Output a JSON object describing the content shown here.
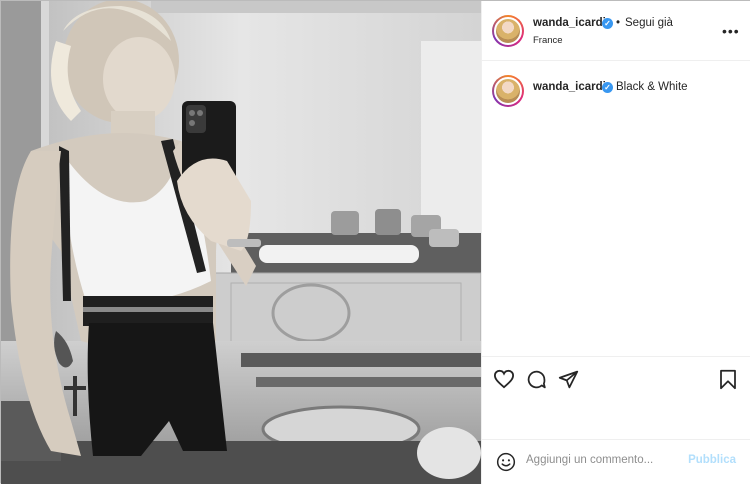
{
  "post": {
    "photo_alt": "Black & White",
    "header": {
      "username": "wanda_icardi",
      "separator": "•",
      "follow_label": "Segui già",
      "location": "France",
      "more_label": "•••"
    },
    "caption": {
      "username": "wanda_icardi",
      "text": "Black & White"
    },
    "actions": {
      "like_icon": "heart-icon",
      "comment_icon": "comment-icon",
      "share_icon": "paper-plane-icon",
      "save_icon": "bookmark-icon"
    },
    "comment_bar": {
      "emoji_icon": "smiley-icon",
      "placeholder": "Aggiungi un commento...",
      "publish_label": "Pubblica"
    }
  },
  "colors": {
    "verified": "#3897f0",
    "publish_disabled": "#b2dffc",
    "text": "#262626",
    "muted": "#8e8e8e"
  }
}
